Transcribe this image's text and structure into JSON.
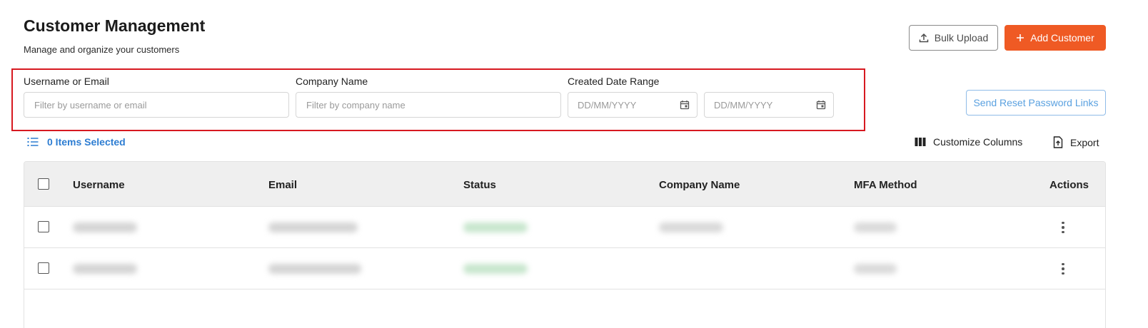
{
  "header": {
    "title": "Customer Management",
    "subtitle": "Manage and organize your customers"
  },
  "actions": {
    "bulk_upload_label": "Bulk Upload",
    "add_customer_label": "Add Customer",
    "reset_password_label": "Send Reset Password Links"
  },
  "filters": {
    "username_label": "Username or Email",
    "username_placeholder": "Filter by username or email",
    "company_label": "Company Name",
    "company_placeholder": "Filter by company name",
    "date_label": "Created Date Range",
    "date_from_placeholder": "DD/MM/YYYY",
    "date_to_placeholder": "DD/MM/YYYY"
  },
  "selection": {
    "text": "0 Items Selected"
  },
  "toolbar": {
    "customize_columns_label": "Customize Columns",
    "export_label": "Export"
  },
  "table": {
    "columns": [
      "Username",
      "Email",
      "Status",
      "Company Name",
      "MFA Method",
      "Actions"
    ]
  },
  "colors": {
    "accent": "#ef5a24",
    "link": "#2d7dd2",
    "highlight_border": "#d71920"
  },
  "icons": [
    "upload-icon",
    "plus-icon",
    "list-icon",
    "calendar-icon",
    "columns-icon",
    "export-icon",
    "kebab-menu-icon"
  ]
}
